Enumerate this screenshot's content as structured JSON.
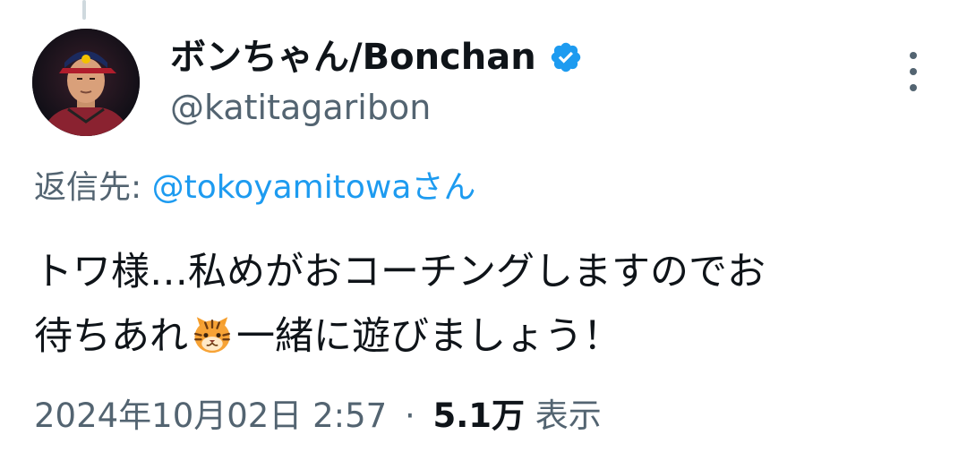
{
  "tweet": {
    "author": {
      "display_name": "ボンちゃん/Bonchan",
      "handle": "@katitagaribon",
      "verified": true
    },
    "reply_prefix": "返信先: ",
    "reply_to": "@tokoyamitowaさん",
    "text_line1": "トワ様…私めがおコーチングしますのでお",
    "text_line2_before": "待ちあれ",
    "emoji": "tiger-face",
    "text_line2_after": "一緒に遊びましょう！",
    "timestamp": "2024年10月02日 2:57",
    "separator": "·",
    "views_count": "5.1万",
    "views_label": "表示"
  },
  "colors": {
    "text": "#0f1419",
    "secondary": "#536471",
    "link": "#1d9bf0",
    "verified": "#1d9bf0"
  }
}
